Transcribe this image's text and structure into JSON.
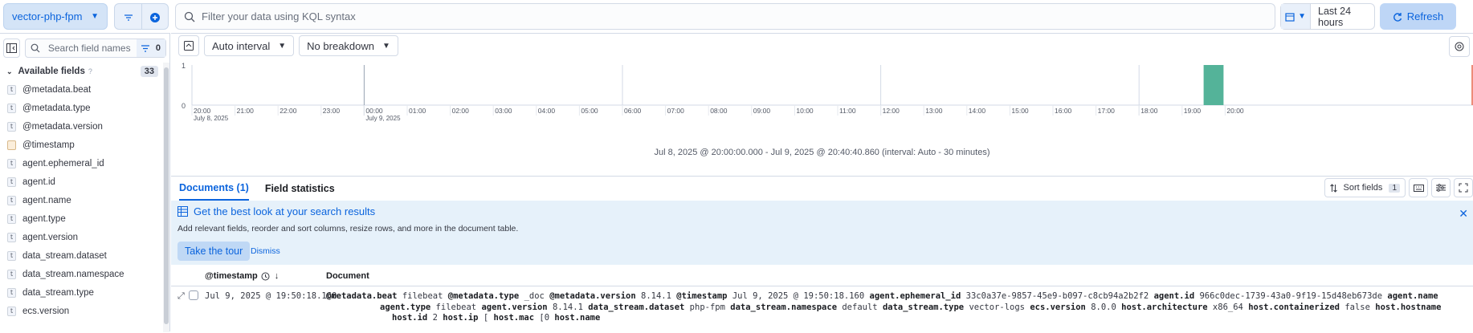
{
  "topbar": {
    "data_view": "vector-php-fpm",
    "query_placeholder": "Filter your data using KQL syntax",
    "time_range": "Last 24 hours",
    "refresh_label": "Refresh"
  },
  "sidebar": {
    "search_placeholder": "Search field names",
    "filter_count": "0",
    "section_title": "Available fields",
    "section_count": "33",
    "fields": [
      {
        "name": "@metadata.beat",
        "type": "t"
      },
      {
        "name": "@metadata.type",
        "type": "t"
      },
      {
        "name": "@metadata.version",
        "type": "t"
      },
      {
        "name": "@timestamp",
        "type": "date"
      },
      {
        "name": "agent.ephemeral_id",
        "type": "t"
      },
      {
        "name": "agent.id",
        "type": "t"
      },
      {
        "name": "agent.name",
        "type": "t"
      },
      {
        "name": "agent.type",
        "type": "t"
      },
      {
        "name": "agent.version",
        "type": "t"
      },
      {
        "name": "data_stream.dataset",
        "type": "t"
      },
      {
        "name": "data_stream.namespace",
        "type": "t"
      },
      {
        "name": "data_stream.type",
        "type": "t"
      },
      {
        "name": "ecs.version",
        "type": "t"
      }
    ]
  },
  "chart_toolbar": {
    "interval": "Auto interval",
    "breakdown": "No breakdown"
  },
  "chart_data": {
    "type": "bar",
    "ylim": [
      0,
      1
    ],
    "y_ticks": [
      "0",
      "1"
    ],
    "x_ticks": [
      "20:00",
      "21:00",
      "22:00",
      "23:00",
      "00:00",
      "01:00",
      "02:00",
      "03:00",
      "04:00",
      "05:00",
      "06:00",
      "07:00",
      "08:00",
      "09:00",
      "10:00",
      "11:00",
      "12:00",
      "13:00",
      "14:00",
      "15:00",
      "16:00",
      "17:00",
      "18:00",
      "19:00",
      "20:00"
    ],
    "x_sublabels": [
      {
        "tick": "20:00",
        "label": "July 8, 2025"
      },
      {
        "tick": "00:00",
        "label": "July 9, 2025"
      }
    ],
    "bars": [
      {
        "x": "19:30",
        "value": 1
      }
    ],
    "bar_color": "#54b399",
    "range_label": "Jul 8, 2025 @ 20:00:00.000 - Jul 9, 2025 @ 20:40:40.860 (interval: Auto - 30 minutes)"
  },
  "tabs": {
    "documents": "Documents (1)",
    "field_stats": "Field statistics",
    "sort_fields": "Sort fields",
    "sort_count": "1"
  },
  "callout": {
    "title": "Get the best look at your search results",
    "description": "Add relevant fields, reorder and sort columns, resize rows, and more in the document table.",
    "tour_button": "Take the tour",
    "dismiss": "Dismiss"
  },
  "grid": {
    "col_timestamp": "@timestamp",
    "col_document": "Document",
    "row": {
      "timestamp": "Jul 9, 2025 @ 19:50:18.160",
      "pairs_line1": [
        [
          "@metadata.beat",
          "filebeat"
        ],
        [
          "@metadata.type",
          "_doc"
        ],
        [
          "@metadata.version",
          "8.14.1"
        ],
        [
          "@timestamp",
          "Jul 9, 2025 @ 19:50:18.160"
        ],
        [
          "agent.ephemeral_id",
          "33c0a37e-9857-45e9-b097-c8cb94a2b2f2"
        ],
        [
          "agent.id",
          "966c0dec-1739-43a0-9f19-15d48eb673de"
        ],
        [
          "agent.name",
          ""
        ]
      ],
      "pairs_line2": [
        [
          "agent.type",
          "filebeat"
        ],
        [
          "agent.version",
          "8.14.1"
        ],
        [
          "data_stream.dataset",
          "php-fpm"
        ],
        [
          "data_stream.namespace",
          "default"
        ],
        [
          "data_stream.type",
          "vector-logs"
        ],
        [
          "ecs.version",
          "8.0.0"
        ],
        [
          "host.architecture",
          "x86_64"
        ],
        [
          "host.containerized",
          "false"
        ],
        [
          "host.hostname",
          ""
        ]
      ],
      "pairs_line3": [
        [
          "host.id",
          "2"
        ],
        [
          "host.ip",
          "["
        ],
        [
          "host.mac",
          "[0"
        ],
        [
          "host.name",
          ""
        ]
      ]
    }
  }
}
